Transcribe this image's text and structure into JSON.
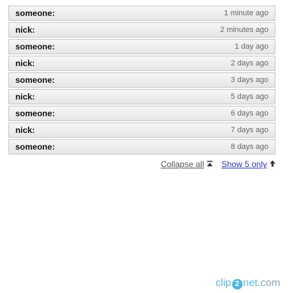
{
  "comments": [
    {
      "author": "someone:",
      "time": "1 minute ago"
    },
    {
      "author": "nick:",
      "time": "2 minutes ago"
    },
    {
      "author": "someone:",
      "time": "1 day ago"
    },
    {
      "author": "nick:",
      "time": "2 days ago"
    },
    {
      "author": "someone:",
      "time": "3 days ago"
    },
    {
      "author": "nick:",
      "time": "5 days ago"
    },
    {
      "author": "someone:",
      "time": "6 days ago"
    },
    {
      "author": "nick:",
      "time": "7 days ago"
    },
    {
      "author": "someone:",
      "time": "8 days ago"
    }
  ],
  "controls": {
    "collapse_label": "Collapse all",
    "show_label": "Show 5 only",
    "collapse_icon": "collapse-up-icon",
    "show_icon": "arrow-up-icon"
  },
  "watermark": {
    "prefix": "clip",
    "middle": "2",
    "suffix": "net",
    "domain": ".com"
  },
  "colors": {
    "link": "#2a36b3",
    "row_border": "#c6c6c6",
    "watermark": "#5bb6e6"
  }
}
